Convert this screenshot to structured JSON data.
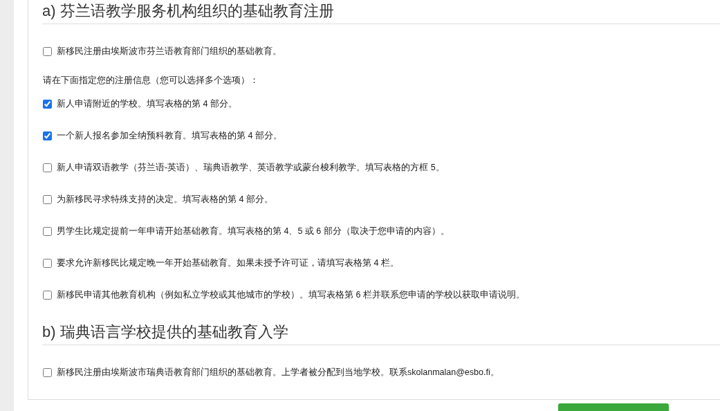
{
  "sections": [
    {
      "title": "a) 芬兰语教学服务机构组织的基础教育注册",
      "items": [
        {
          "kind": "checkbox",
          "label": "新移民注册由埃斯波市芬兰语教育部门组织的基础教育。",
          "checked": false
        },
        {
          "kind": "text",
          "label": "请在下面指定您的注册信息（您可以选择多个选项）："
        },
        {
          "kind": "checkbox",
          "label": "新人申请附近的学校。填写表格的第 4 部分。",
          "checked": true
        },
        {
          "kind": "checkbox",
          "label": "一个新人报名参加全纳预科教育。填写表格的第 4 部分。",
          "checked": true
        },
        {
          "kind": "checkbox",
          "label": "新人申请双语教学（芬兰语-英语）、瑞典语教学、英语教学或蒙台梭利教学。填写表格的方框 5。",
          "checked": false
        },
        {
          "kind": "checkbox",
          "label": "为新移民寻求特殊支持的决定。填写表格的第 4 部分。",
          "checked": false
        },
        {
          "kind": "checkbox",
          "label": "男学生比规定提前一年申请开始基础教育。填写表格的第 4、5 或 6 部分（取决于您申请的内容）。",
          "checked": false
        },
        {
          "kind": "checkbox",
          "label": "要求允许新移民比规定晚一年开始基础教育。如果未授予许可证，请填写表格第 4 栏。",
          "checked": false
        },
        {
          "kind": "checkbox",
          "label": "新移民申请其他教育机构（例如私立学校或其他城市的学校）。填写表格第 6 栏并联系您申请的学校以获取申请说明。",
          "checked": false
        }
      ]
    },
    {
      "title": "b) 瑞典语言学校提供的基础教育入学",
      "items": [
        {
          "kind": "checkbox",
          "label": "新移民注册由埃斯波市瑞典语教育部门组织的基础教育。上学者被分配到当地学校。联系skolanmalan@esbo.fi。",
          "checked": false
        }
      ]
    }
  ]
}
